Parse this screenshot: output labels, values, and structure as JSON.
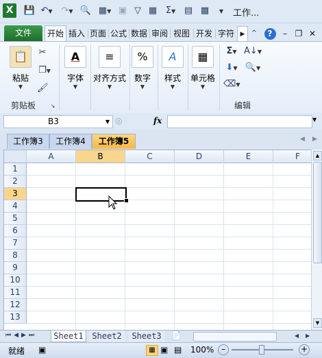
{
  "title_bar": {
    "app_icon_label": "X",
    "window_title": "工作..."
  },
  "ribbon_tabs": [
    "文件",
    "开始",
    "插入",
    "页面",
    "公式",
    "数据",
    "审阅",
    "视图",
    "开发",
    "字符"
  ],
  "ribbon": {
    "clipboard": {
      "paste_label": "粘贴",
      "group_label": "剪贴板"
    },
    "font": {
      "label": "字体"
    },
    "alignment": {
      "label": "对齐方式"
    },
    "number": {
      "label": "数字"
    },
    "styles": {
      "label": "样式"
    },
    "cells": {
      "label": "单元格"
    },
    "editing": {
      "group_label": "编辑"
    }
  },
  "formula_bar": {
    "name_box_value": "B3",
    "fx_label": "fx",
    "formula_value": ""
  },
  "workbook_tabs": [
    {
      "label": "工作簿3",
      "active": false
    },
    {
      "label": "工作簿4",
      "active": false
    },
    {
      "label": "工作簿5",
      "active": true
    }
  ],
  "grid": {
    "columns": [
      "A",
      "B",
      "C",
      "D",
      "E",
      "F"
    ],
    "rows": [
      "1",
      "2",
      "3",
      "4",
      "5",
      "6",
      "7",
      "8",
      "9",
      "10",
      "11",
      "12",
      "13"
    ],
    "selected_cell": "B3"
  },
  "sheet_tabs": [
    {
      "label": "Sheet1",
      "active": true
    },
    {
      "label": "Sheet2",
      "active": false
    },
    {
      "label": "Sheet3",
      "active": false
    }
  ],
  "status_bar": {
    "mode": "就绪",
    "zoom": "100%"
  },
  "colors": {
    "file_tab": "#2a8a3a",
    "selection_header": "#f9d68c",
    "active_workbook_tab": "#f7b84a"
  }
}
